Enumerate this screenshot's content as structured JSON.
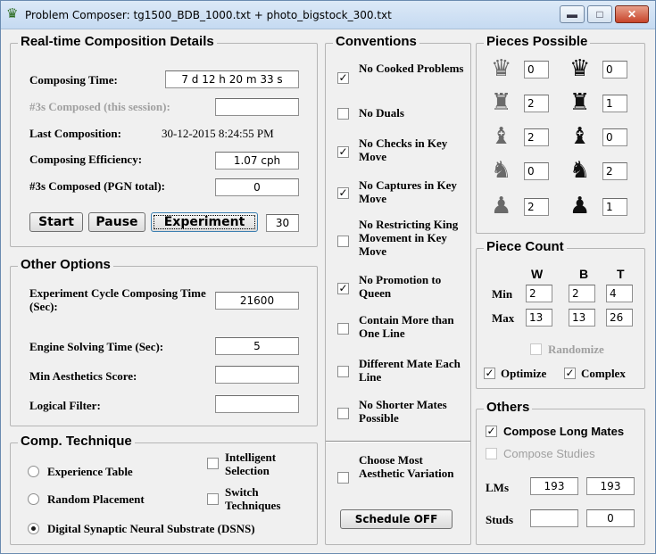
{
  "window": {
    "title": "Problem Composer: tg1500_BDB_1000.txt + photo_bigstock_300.txt",
    "app_icon": "queen-crown-icon",
    "controls": {
      "minimize": "▬",
      "maximize": "□",
      "close": "✕"
    }
  },
  "realtime": {
    "legend": "Real-time Composition Details",
    "composing_time_label": "Composing Time:",
    "composing_time_value": "7 d 12 h 20 m 33 s",
    "composed_session_label": "#3s Composed (this session):",
    "composed_session_value": "",
    "last_composition_label": "Last Composition:",
    "last_composition_value": "30-12-2015 8:24:55 PM",
    "efficiency_label": "Composing Efficiency:",
    "efficiency_value": "1.07 cph",
    "pgn_total_label": "#3s Composed (PGN total):",
    "pgn_total_value": "0",
    "start_label": "Start",
    "pause_label": "Pause",
    "experiment_label": "Experiment",
    "experiment_value": "30"
  },
  "other_options": {
    "legend": "Other Options",
    "cycle_label": "Experiment Cycle Composing Time (Sec):",
    "cycle_value": "21600",
    "engine_label": "Engine Solving Time (Sec):",
    "engine_value": "5",
    "aesthetics_label": "Min Aesthetics Score:",
    "aesthetics_value": "",
    "logical_label": "Logical Filter:",
    "logical_value": ""
  },
  "technique": {
    "legend": "Comp. Technique",
    "experience_table": "Experience Table",
    "random_placement": "Random Placement",
    "dsns": "Digital Synaptic Neural Substrate (DSNS)",
    "intelligent_selection": "Intelligent Selection",
    "switch_techniques": "Switch Techniques"
  },
  "conventions": {
    "legend": "Conventions",
    "items": [
      {
        "label": "No Cooked Problems",
        "checked": "✓"
      },
      {
        "label": "No Duals",
        "checked": ""
      },
      {
        "label": "No Checks in Key Move",
        "checked": "✓"
      },
      {
        "label": "No Captures in Key Move",
        "checked": "✓"
      },
      {
        "label": "No Restricting King Movement in Key Move",
        "checked": ""
      },
      {
        "label": "No Promotion to Queen",
        "checked": "✓"
      },
      {
        "label": "Contain More than One Line",
        "checked": ""
      },
      {
        "label": "Different Mate Each Line",
        "checked": ""
      },
      {
        "label": "No Shorter Mates Possible",
        "checked": ""
      }
    ],
    "aesthetic_label": "Choose Most Aesthetic Variation",
    "schedule_label": "Schedule OFF"
  },
  "pieces": {
    "legend": "Pieces Possible",
    "glyphs": {
      "queen": "♛",
      "rook": "♜",
      "bishop": "♝",
      "knight": "♞",
      "pawn": "♟"
    },
    "white": {
      "queen": "0",
      "rook": "2",
      "bishop": "2",
      "knight": "0",
      "pawn": "2"
    },
    "black": {
      "queen": "0",
      "rook": "1",
      "bishop": "0",
      "knight": "2",
      "pawn": "1"
    }
  },
  "piece_count": {
    "legend": "Piece Count",
    "col_w": "W",
    "col_b": "B",
    "col_t": "T",
    "min_label": "Min",
    "max_label": "Max",
    "min": {
      "w": "2",
      "b": "2",
      "t": "4"
    },
    "max": {
      "w": "13",
      "b": "13",
      "t": "26"
    },
    "randomize_label": "Randomize",
    "optimize_label": "Optimize",
    "complex_label": "Complex"
  },
  "others": {
    "legend": "Others",
    "long_mates_label": "Compose Long Mates",
    "studies_label": "Compose Studies",
    "lms_label": "LMs",
    "lms_a": "193",
    "lms_b": "193",
    "studs_label": "Studs",
    "studs_a": "",
    "studs_b": "0"
  },
  "checkmark": "✓"
}
